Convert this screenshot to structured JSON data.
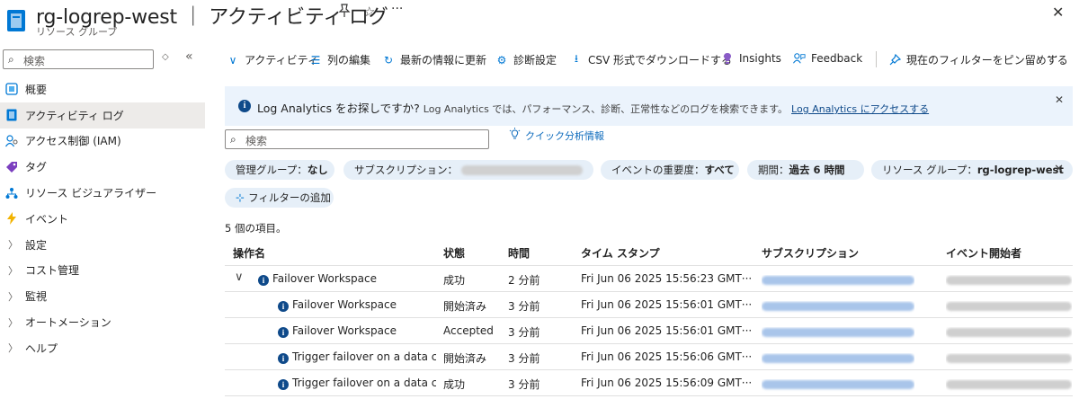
{
  "header": {
    "title": "rg-logrep-west ｜ アクティビティ ログ",
    "subtitle": "リソース グループ"
  },
  "sidebar": {
    "search_placeholder": "検索",
    "items": [
      {
        "label": "概要",
        "icon": "overview-icon"
      },
      {
        "label": "アクティビティ ログ",
        "icon": "activity-log-icon",
        "selected": true
      },
      {
        "label": "アクセス制御 (IAM)",
        "icon": "iam-icon"
      },
      {
        "label": "タグ",
        "icon": "tag-icon"
      },
      {
        "label": "リソース ビジュアライザー",
        "icon": "visualizer-icon"
      },
      {
        "label": "イベント",
        "icon": "events-icon"
      },
      {
        "label": "設定",
        "icon": "chevron-right-icon"
      },
      {
        "label": "コスト管理",
        "icon": "chevron-right-icon"
      },
      {
        "label": "監視",
        "icon": "chevron-right-icon"
      },
      {
        "label": "オートメーション",
        "icon": "chevron-right-icon"
      },
      {
        "label": "ヘルプ",
        "icon": "chevron-right-icon"
      }
    ]
  },
  "toolbar": {
    "activity": "アクティビティ",
    "edit_columns": "列の編集",
    "refresh": "最新の情報に更新",
    "diagnostic": "診断設定",
    "download_csv": "CSV 形式でダウンロードする",
    "insights": "Insights",
    "feedback": "Feedback",
    "pin_filter": "現在のフィルターをピン留めする"
  },
  "banner": {
    "title": "Log Analytics をお探しですか?",
    "desc": "Log Analytics では、パフォーマンス、診断、正常性などのログを検索できます。",
    "link": "Log Analytics にアクセスする"
  },
  "search": {
    "placeholder": "検索",
    "quick_insights": "クイック分析情報"
  },
  "filters": {
    "mgmt_group_label": "管理グループ：",
    "mgmt_group_value": "なし",
    "subscription_label": "サブスクリプション：",
    "severity_label": "イベントの重要度：",
    "severity_value": "すべて",
    "period_label": "期間：",
    "period_value": "過去 6 時間",
    "rg_label": "リソース グループ：",
    "rg_value": "rg-logrep-west",
    "add_filter": "フィルターの追加"
  },
  "item_count": "5 個の項目。",
  "table": {
    "headers": [
      "操作名",
      "状態",
      "時間",
      "タイム スタンプ",
      "サブスクリプション",
      "イベント開始者"
    ],
    "rows": [
      {
        "name": "Failover Workspace",
        "status": "成功",
        "time": "2 分前",
        "timestamp": "Fri Jun 06 2025 15:56:23 GMT···",
        "parent": true
      },
      {
        "name": "Failover Workspace",
        "status": "開始済み",
        "time": "3 分前",
        "timestamp": "Fri Jun 06 2025 15:56:01 GMT···"
      },
      {
        "name": "Failover Workspace",
        "status": "Accepted",
        "time": "3 分前",
        "timestamp": "Fri Jun 06 2025 15:56:01 GMT···"
      },
      {
        "name": "Trigger failover on a data cc",
        "status": "開始済み",
        "time": "3 分前",
        "timestamp": "Fri Jun 06 2025 15:56:06 GMT···"
      },
      {
        "name": "Trigger failover on a data cc",
        "status": "成功",
        "time": "3 分前",
        "timestamp": "Fri Jun 06 2025 15:56:09 GMT···"
      }
    ]
  },
  "colors": {
    "accent": "#0078d4",
    "banner_bg": "#ebf3fc",
    "pill_bg": "#e6eff8",
    "selected_nav": "#edebe9"
  }
}
